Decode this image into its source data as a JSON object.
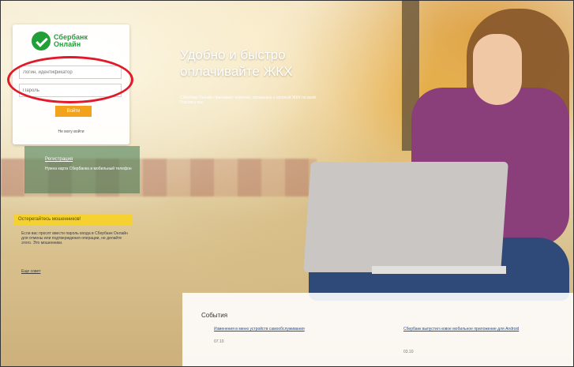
{
  "logo": {
    "line1": "Сбербанк",
    "line2": "Онлайн"
  },
  "login": {
    "login_placeholder": "Логин, идентификатор",
    "password_placeholder": "Пароль",
    "submit_label": "Войти",
    "forgot_label": "Не могу войти"
  },
  "registration": {
    "link_label": "Регистрация",
    "text": "Нужна карта Сбербанка и мобильный телефон"
  },
  "promo": {
    "headline_line1": "Удобно и быстро",
    "headline_line2": "оплачивайте ЖКХ",
    "text": "Сбербанк Онлайн принимает платежи, связанные с оплатой ЖКХ по всей России у вас"
  },
  "notice": {
    "title": "Остерегайтесь мошенников!",
    "text": "Если вас просят ввести пароль входа в Сбербанк Онлайн для отмены или подтверждения операции, не делайте этого. Это мошенники.",
    "more_label": "Еще совет"
  },
  "events": {
    "title": "События",
    "items": [
      {
        "label": "Изменения в меню устройств самообслуживания",
        "date": "07.10"
      },
      {
        "label": "Сбербанк выпустил новое мобильное приложение для Android",
        "date": "03.10"
      }
    ]
  },
  "colors": {
    "brand_green": "#21a038",
    "button_orange": "#f3a21b",
    "notice_yellow": "#f5d232",
    "highlight_red": "#e0192b"
  }
}
